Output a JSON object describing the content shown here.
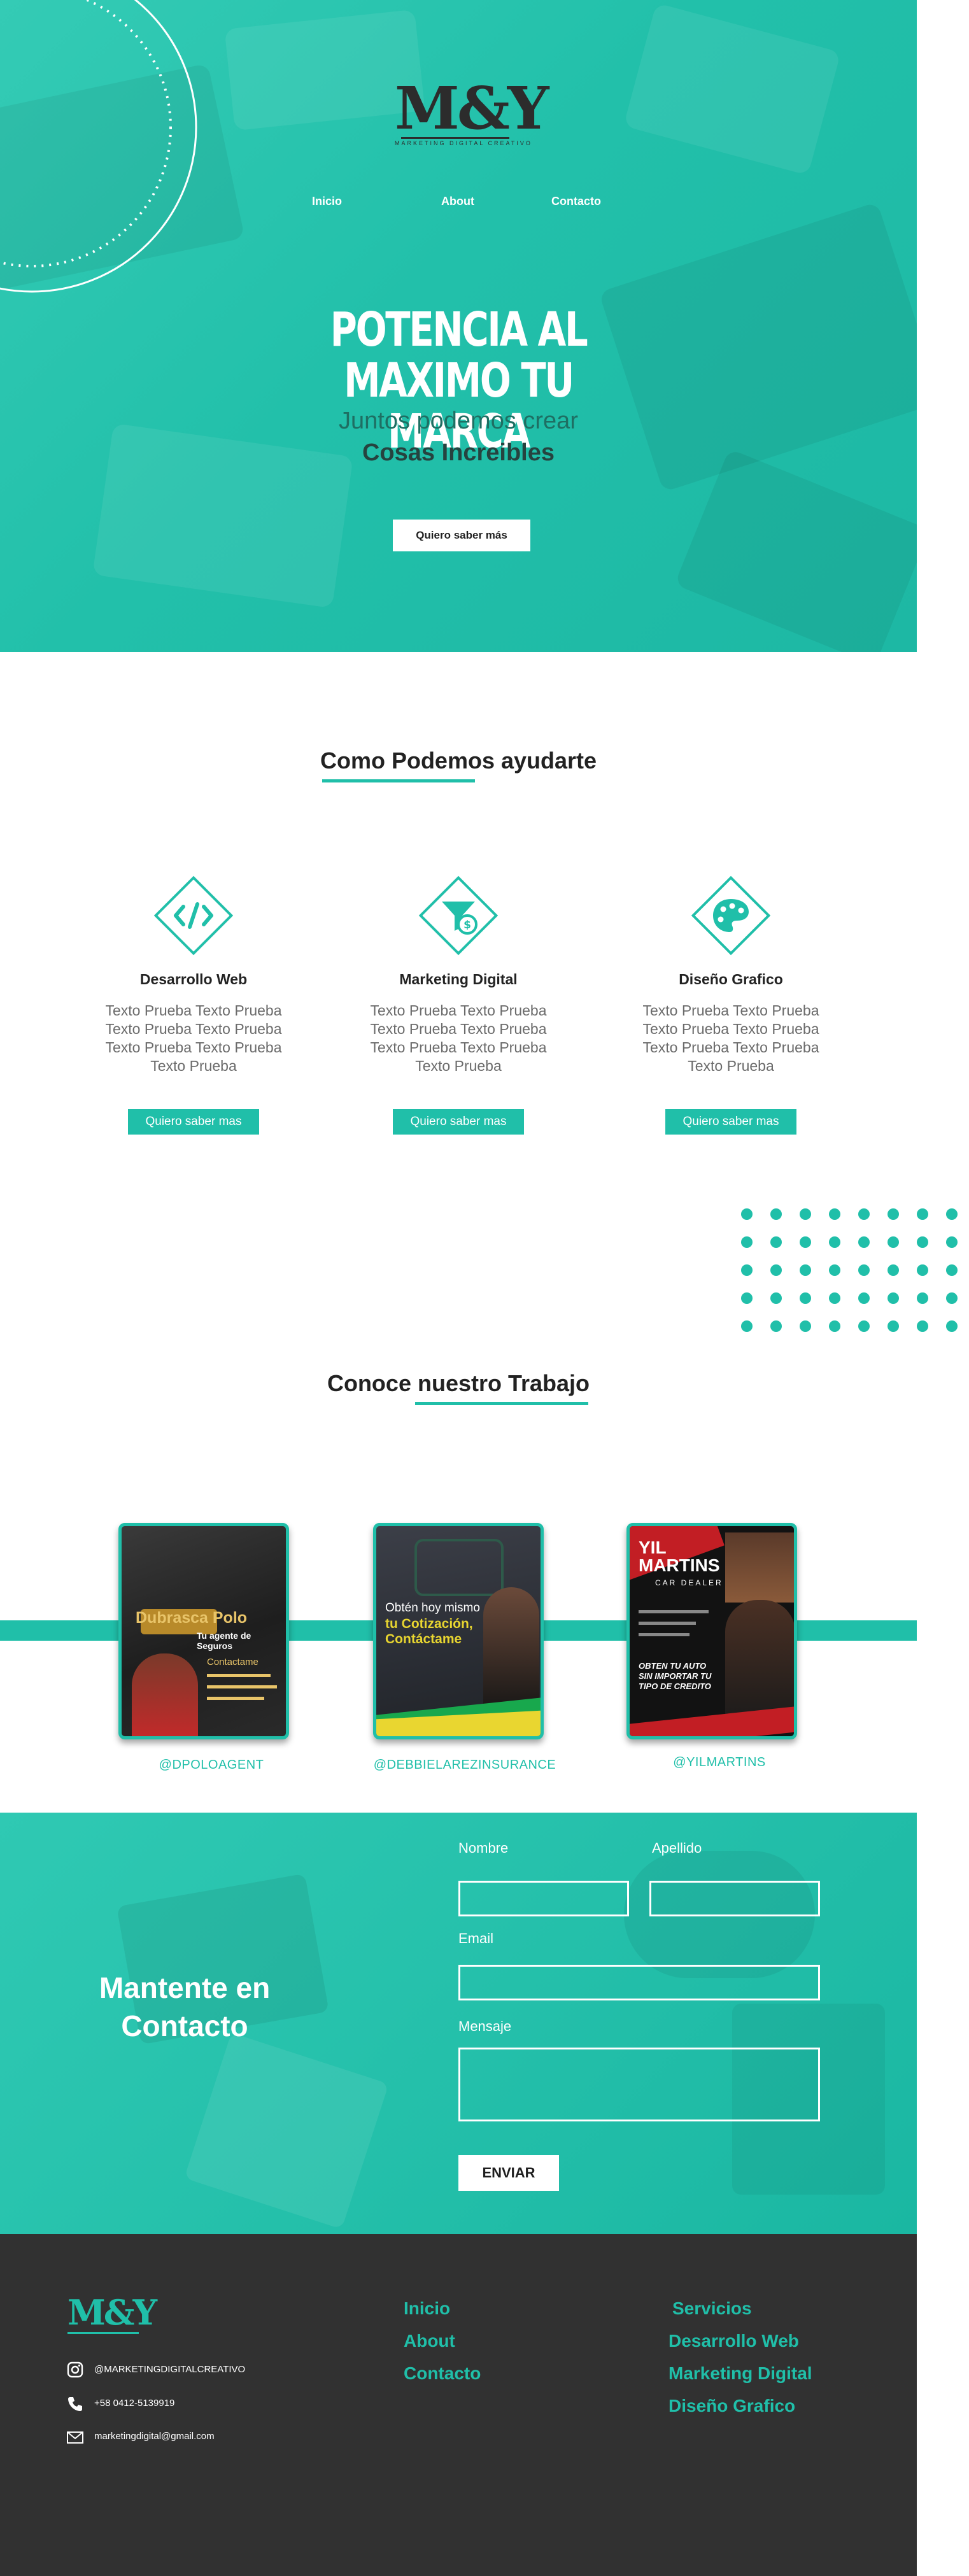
{
  "brand": {
    "logo": "M&Y",
    "tagline": "MARKETING DIGITAL CREATIVO",
    "accent_color": "#20bfa9",
    "dark_color": "#313131"
  },
  "nav": {
    "items": [
      "Inicio",
      "About",
      "Contacto"
    ]
  },
  "hero": {
    "title_line1": "POTENCIA AL",
    "title_line2": "MAXIMO TU MARCA",
    "subtitle": "Juntos podemos crear",
    "subtitle_bold": "Cosas Increibles",
    "cta": "Quiero saber más"
  },
  "services": {
    "title": "Como Podemos ayudarte",
    "items": [
      {
        "name": "Desarrollo Web",
        "icon": "code-icon",
        "text": "Texto Prueba Texto Prueba Texto Prueba Texto Prueba Texto Prueba Texto Prueba Texto Prueba",
        "button": "Quiero saber mas"
      },
      {
        "name": "Marketing Digital",
        "icon": "funnel-money-icon",
        "text": "Texto Prueba Texto Prueba Texto Prueba Texto Prueba Texto Prueba Texto Prueba Texto Prueba",
        "button": "Quiero saber mas"
      },
      {
        "name": "Diseño Grafico",
        "icon": "palette-icon",
        "text": "Texto Prueba Texto Prueba Texto Prueba Texto Prueba Texto Prueba Texto Prueba Texto Prueba",
        "button": "Quiero saber mas"
      }
    ]
  },
  "work": {
    "title": "Conoce nuestro Trabajo",
    "items": [
      {
        "handle": "@DPOLOAGENT",
        "card_title": "Dubrasca Polo",
        "card_sub": "Tu agente de Seguros",
        "card_extra": "Contactame"
      },
      {
        "handle": "@DEBBIELAREZINSURANCE",
        "card_title": "Obtén hoy mismo",
        "card_sub": "tu Cotización,",
        "card_extra": "Contáctame"
      },
      {
        "handle": "@YILMARTINS",
        "card_title": "YIL MARTINS",
        "card_sub": "CAR DEALER",
        "card_extra": "OBTEN TU AUTO SIN IMPORTAR TU TIPO DE CREDITO"
      }
    ]
  },
  "contact": {
    "title_line1": "Mantente en",
    "title_line2": "Contacto",
    "fields": {
      "nombre": "Nombre",
      "apellido": "Apellido",
      "email": "Email",
      "mensaje": "Mensaje"
    },
    "send": "ENVIAR"
  },
  "footer": {
    "logo": "M&Y",
    "instagram": "@MARKETINGDIGITALCREATIVO",
    "phone": "+58 0412-5139919",
    "email": "marketingdigital@gmail.com",
    "links": [
      "Inicio",
      "About",
      "Contacto"
    ],
    "services_title": "Servicios",
    "services": [
      "Desarrollo Web",
      "Marketing Digital",
      "Diseño Grafico"
    ]
  }
}
